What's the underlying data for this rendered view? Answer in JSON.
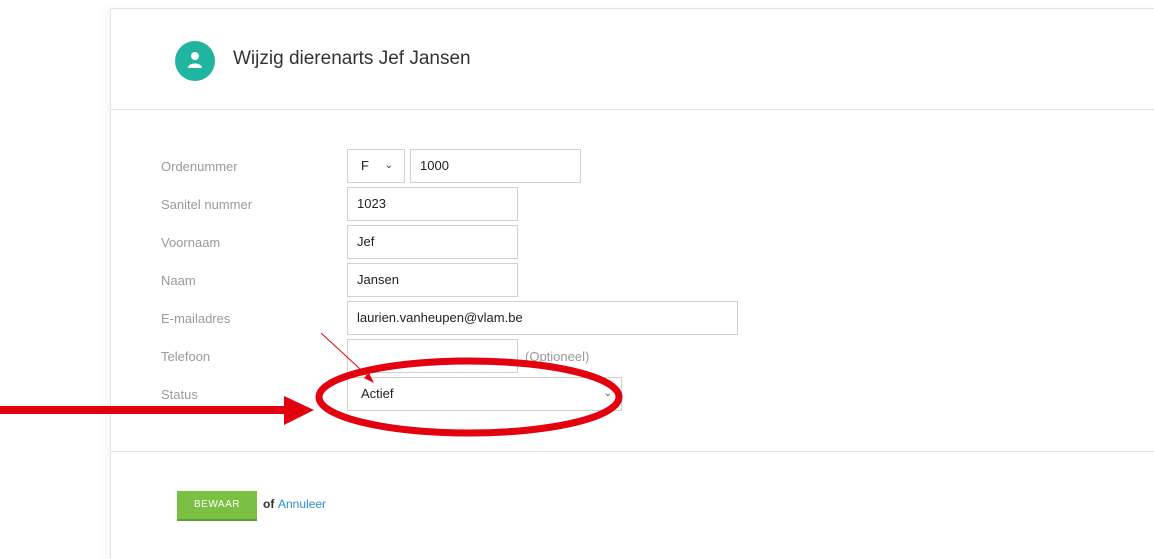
{
  "header": {
    "title": "Wijzig dierenarts Jef Jansen",
    "avatar_icon": "user-icon"
  },
  "form": {
    "ordenummer": {
      "label": "Ordenummer",
      "prefix": "F",
      "value": "1000"
    },
    "sanitel": {
      "label": "Sanitel nummer",
      "value": "1023"
    },
    "voornaam": {
      "label": "Voornaam",
      "value": "Jef"
    },
    "naam": {
      "label": "Naam",
      "value": "Jansen"
    },
    "email": {
      "label": "E-mailadres",
      "value": "laurien.vanheupen@vlam.be"
    },
    "telefoon": {
      "label": "Telefoon",
      "value": "",
      "hint": "(Optioneel)"
    },
    "status": {
      "label": "Status",
      "value": "Actief"
    }
  },
  "footer": {
    "save_label": "BEWAAR",
    "or_text": "of",
    "cancel_label": "Annuleer"
  },
  "colors": {
    "accent": "#1fb5a0",
    "save_button": "#7ac143",
    "link": "#2a8fd0",
    "annotation": "#e3000f"
  }
}
